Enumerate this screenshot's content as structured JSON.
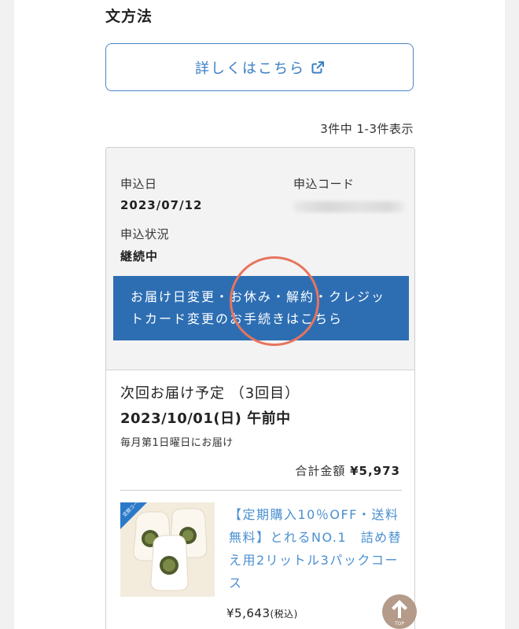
{
  "section": {
    "title": "文方法"
  },
  "details_button": {
    "label": "詳しくはこちら",
    "icon": "external-link-icon"
  },
  "result_count": "3件中 1-3件表示",
  "application": {
    "date_label": "申込日",
    "date_value": "2023/07/12",
    "code_label": "申込コード",
    "status_label": "申込状況",
    "status_value": "継続中"
  },
  "procedure_button": {
    "label": "お届け日変更・お休み・解約・クレジットカード変更のお手続きはこちら"
  },
  "next_delivery": {
    "title": "次回お届け予定 （3回目）",
    "date": "2023/10/01(日) 午前中",
    "schedule": "毎月第1日曜日にお届け"
  },
  "total": {
    "label": "合計金額",
    "amount": "¥5,973"
  },
  "product": {
    "badge": "定期コース",
    "name": "【定期購入10％OFF・送料無料】とれるNO.1　詰め替え用2リットル3パックコース",
    "price": "¥5,643",
    "tax": "(税込)"
  },
  "top_button": {
    "label": "TOP"
  },
  "colors": {
    "primary_blue": "#2d6eb3",
    "link_blue": "#4a8fd0",
    "highlight": "#e8745e",
    "top_button": "#b59b8a"
  }
}
